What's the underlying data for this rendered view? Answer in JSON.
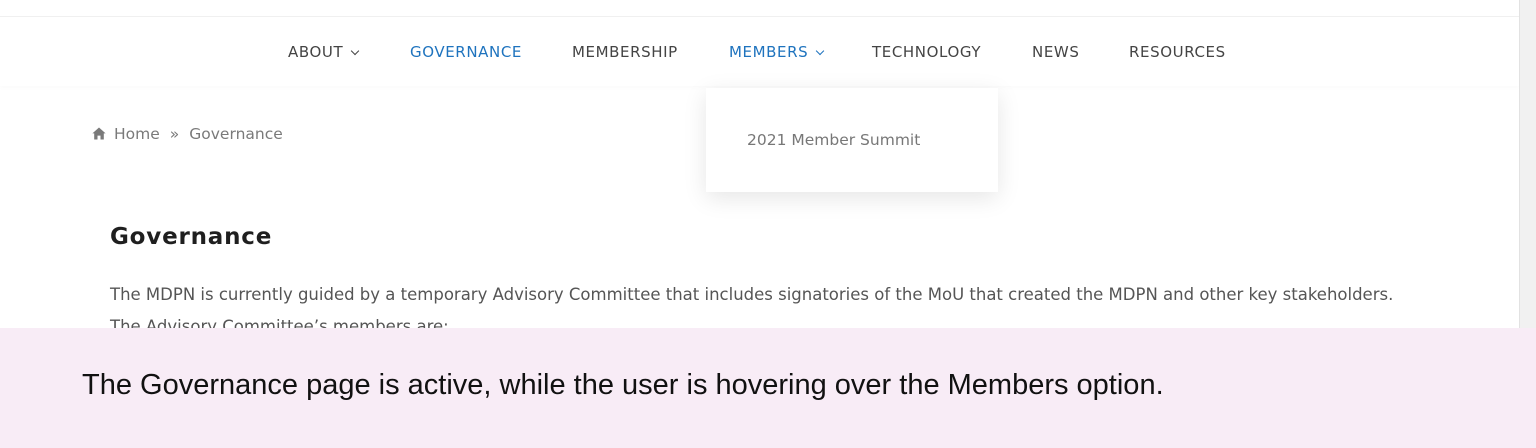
{
  "nav": {
    "items": [
      {
        "label": "ABOUT",
        "has_dropdown": true,
        "active": false
      },
      {
        "label": "GOVERNANCE",
        "has_dropdown": false,
        "active": true
      },
      {
        "label": "MEMBERSHIP",
        "has_dropdown": false,
        "active": false
      },
      {
        "label": "MEMBERS",
        "has_dropdown": true,
        "hovered": true
      },
      {
        "label": "TECHNOLOGY",
        "has_dropdown": false,
        "active": false
      },
      {
        "label": "NEWS",
        "has_dropdown": false,
        "active": false
      },
      {
        "label": "RESOURCES",
        "has_dropdown": false,
        "active": false
      }
    ],
    "active_color": "#1e73be",
    "text_color": "#444444"
  },
  "dropdown": {
    "items": [
      "2021 Member Summit"
    ]
  },
  "breadcrumb": {
    "home_icon": "home-icon",
    "home": "Home",
    "separator": "»",
    "current": "Governance"
  },
  "main": {
    "title": "Governance",
    "paragraph": "The MDPN is currently guided by a temporary Advisory Committee that includes signatories of the MoU that created the MDPN and other key stakeholders. The Advisory Committee’s members are:"
  },
  "caption": {
    "text": "The Governance page is active, while the user is hovering over the Members option."
  }
}
